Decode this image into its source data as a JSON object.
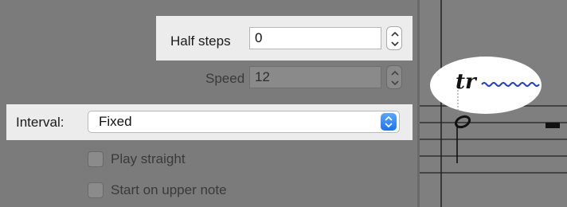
{
  "half_steps": {
    "label": "Half steps",
    "value": "0"
  },
  "speed": {
    "label": "Speed",
    "value": "12"
  },
  "interval": {
    "label": "Interval:",
    "selected": "Fixed"
  },
  "options": [
    {
      "label": "Play straight",
      "checked": false
    },
    {
      "label": "Start on upper note",
      "checked": false
    }
  ],
  "score": {
    "trill_symbol": "tr"
  },
  "colors": {
    "accent": "#1a72f0",
    "trill_line": "#1e3cd8"
  }
}
